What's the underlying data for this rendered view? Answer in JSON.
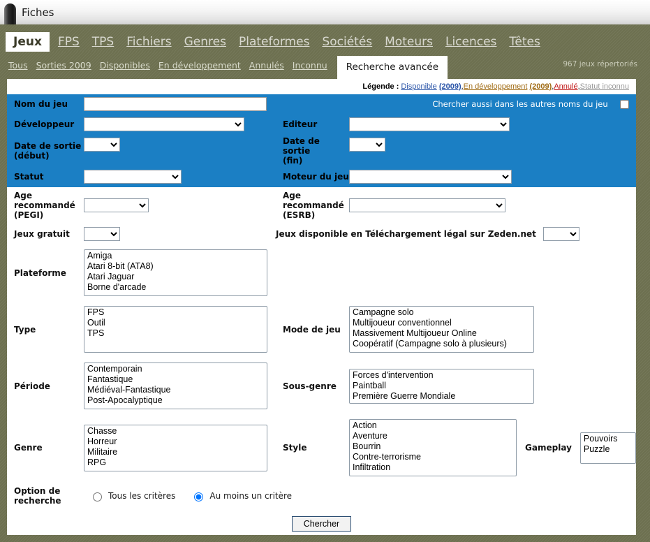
{
  "window": {
    "title": "Fiches"
  },
  "topnav": {
    "items": [
      {
        "label": "Jeux",
        "active": true
      },
      {
        "label": "FPS",
        "active": false
      },
      {
        "label": "TPS",
        "active": false
      },
      {
        "label": "Fichiers",
        "active": false
      },
      {
        "label": "Genres",
        "active": false
      },
      {
        "label": "Plateformes",
        "active": false
      },
      {
        "label": "Sociétés",
        "active": false
      },
      {
        "label": "Moteurs",
        "active": false
      },
      {
        "label": "Licences",
        "active": false
      },
      {
        "label": "Têtes",
        "active": false
      }
    ]
  },
  "subnav": {
    "items": [
      {
        "label": "Tous",
        "active": false
      },
      {
        "label": "Sorties 2009",
        "active": false
      },
      {
        "label": "Disponibles",
        "active": false
      },
      {
        "label": "En développement",
        "active": false
      },
      {
        "label": "Annulés",
        "active": false
      },
      {
        "label": "Inconnu",
        "active": false
      },
      {
        "label": "Recherche avancée",
        "active": true
      }
    ],
    "count": "967 jeux répertoriés"
  },
  "legend": {
    "title": "Légende :",
    "disponible": "Disponible",
    "disponible_year": "(2009)",
    "sep1": ", ",
    "endev": "En développement",
    "endev_year": "(2009)",
    "sep2": ", ",
    "annule": "Annulé",
    "sep3": ", ",
    "inconnu": "Statut inconnu"
  },
  "form": {
    "nom_du_jeu": {
      "label": "Nom du jeu",
      "value": "",
      "placeholder": ""
    },
    "chercher_autres_noms": {
      "label": "Chercher aussi dans les autres noms du jeu",
      "checked": false
    },
    "developpeur": {
      "label": "Développeur",
      "value": ""
    },
    "editeur": {
      "label": "Editeur",
      "value": ""
    },
    "date_sortie_debut": {
      "label": "Date de sortie (début)",
      "value": ""
    },
    "date_sortie_fin": {
      "label": "Date de sortie (fin)",
      "value": ""
    },
    "statut": {
      "label": "Statut",
      "value": ""
    },
    "moteur_du_jeu": {
      "label": "Moteur du jeu",
      "value": ""
    },
    "age_pegi": {
      "label": "Age recommandé (PEGI)",
      "value": ""
    },
    "age_esrb": {
      "label": "Age recommandé (ESRB)",
      "value": ""
    },
    "jeux_gratuit": {
      "label": "Jeux gratuit",
      "value": ""
    },
    "jeux_dispo_dl": {
      "label": "Jeux disponible en Téléchargement légal sur Zeden.net",
      "value": ""
    },
    "plateforme": {
      "label": "Plateforme",
      "options": [
        "Amiga",
        "Atari 8-bit (ATA8)",
        "Atari Jaguar",
        "Borne d'arcade"
      ]
    },
    "type": {
      "label": "Type",
      "options": [
        "FPS",
        "Outil",
        "TPS"
      ]
    },
    "mode_de_jeu": {
      "label": "Mode de jeu",
      "options": [
        "Campagne solo",
        "Multijoueur conventionnel",
        "Massivement Multijoueur Online",
        "Coopératif (Campagne solo à plusieurs)"
      ]
    },
    "periode": {
      "label": "Période",
      "options": [
        "Contemporain",
        "Fantastique",
        "Médiéval-Fantastique",
        "Post-Apocalyptique"
      ]
    },
    "sous_genre": {
      "label": "Sous-genre",
      "options": [
        "Forces d'intervention",
        "Paintball",
        "Première Guerre Mondiale"
      ]
    },
    "genre": {
      "label": "Genre",
      "options": [
        "Chasse",
        "Horreur",
        "Militaire",
        "RPG"
      ]
    },
    "style": {
      "label": "Style",
      "options": [
        "Action",
        "Aventure",
        "Bourrin",
        "Contre-terrorisme",
        "Infiltration"
      ]
    },
    "gameplay": {
      "label": "Gameplay",
      "options": [
        "Pouvoirs",
        "Puzzle"
      ]
    },
    "option_recherche": {
      "label": "Option de recherche",
      "choice_all": "Tous les critères",
      "choice_any": "Au moins un critère",
      "selected": "any"
    },
    "submit": {
      "label": "Chercher"
    }
  },
  "colors": {
    "olive": "#6d7050",
    "blue_zone": "#1b7fc4",
    "legend_disponible": "#2b55a8",
    "legend_endev": "#a06b14",
    "legend_annule": "#c11b1b",
    "legend_inconnu": "#9a9a9a"
  }
}
